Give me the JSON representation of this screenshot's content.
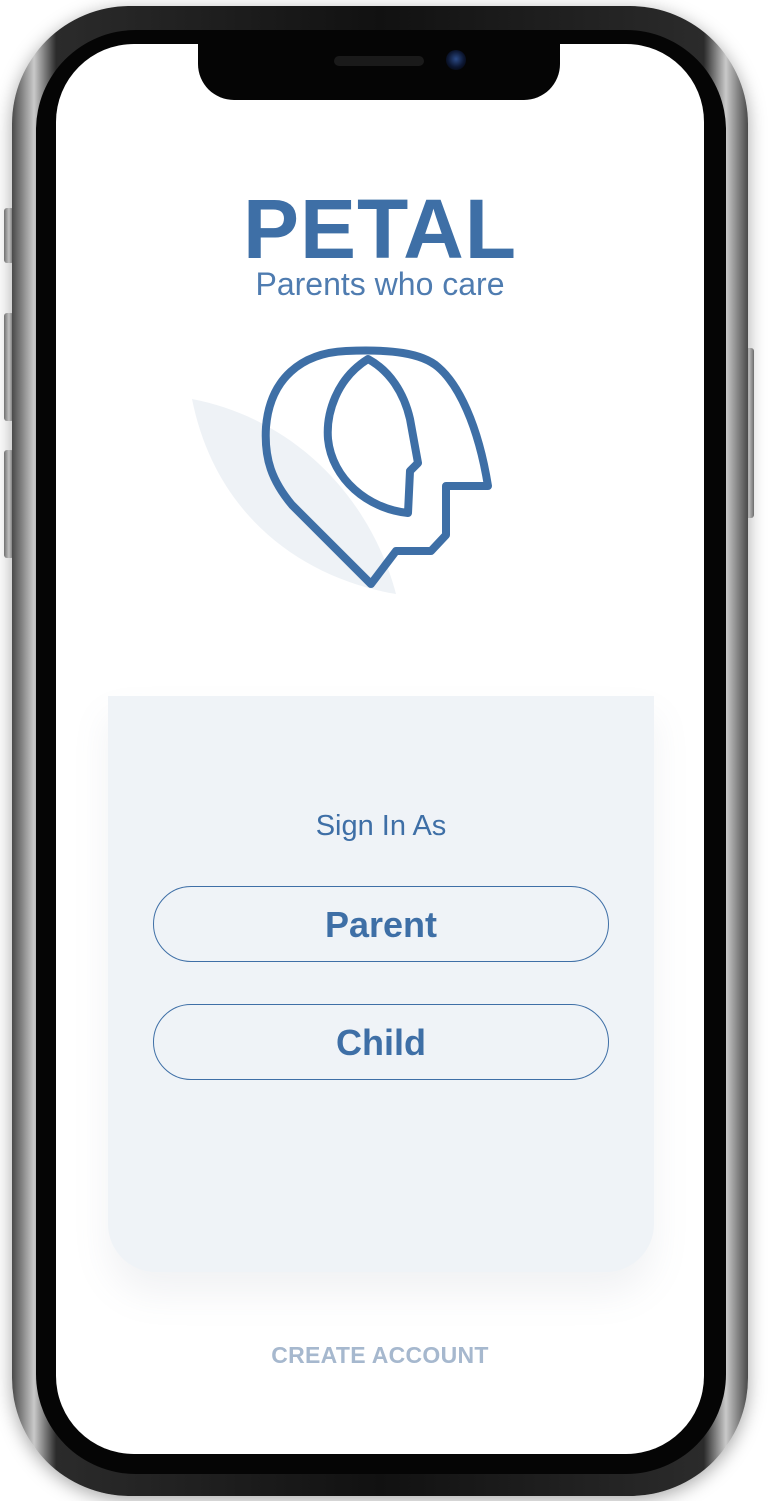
{
  "app": {
    "name": "PETAL",
    "tagline": "Parents who care"
  },
  "colors": {
    "brand_blue": "#3e6fa6",
    "card_background": "#eff3f7",
    "link_muted": "#a6b8ce",
    "leaf_shadow": "#eef2f6"
  },
  "icons": {
    "logo": "petal-head-profile-icon"
  },
  "sign_in": {
    "heading": "Sign In As",
    "options": [
      {
        "label": "Parent"
      },
      {
        "label": "Child"
      }
    ]
  },
  "footer": {
    "create_account_label": "CREATE ACCOUNT"
  }
}
